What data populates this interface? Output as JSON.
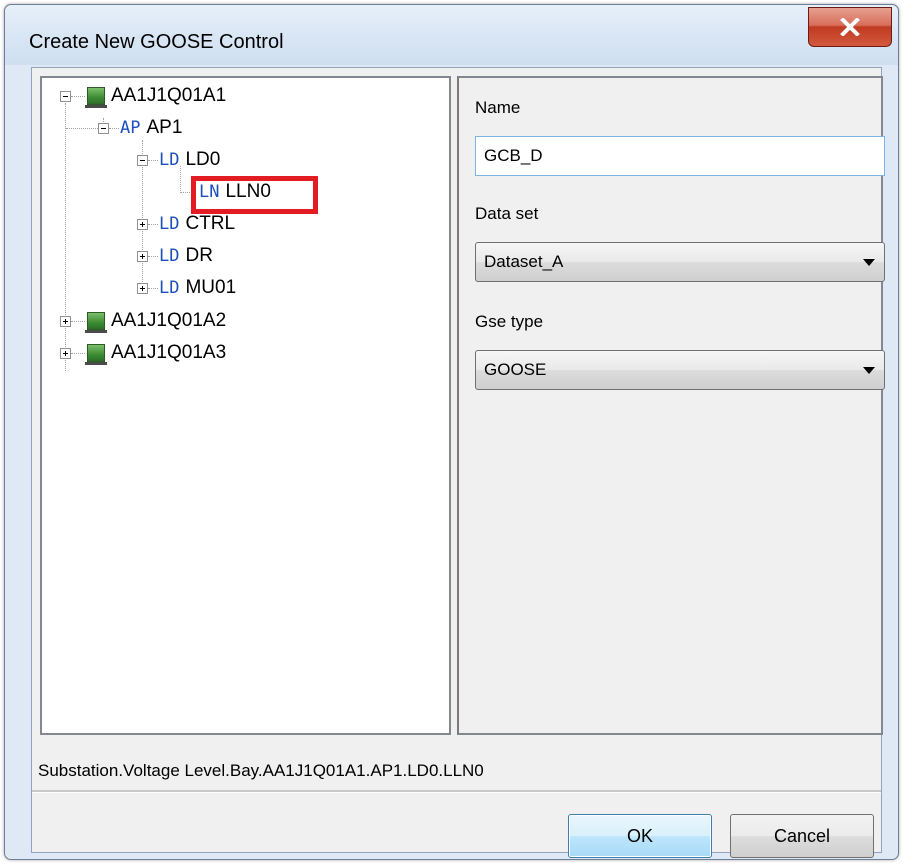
{
  "window": {
    "title": "Create New GOOSE Control",
    "close_label": "X"
  },
  "tree": {
    "nodes": [
      {
        "id": "ied1",
        "label": "AA1J1Q01A1",
        "kind": "",
        "icon": "ied-icon",
        "expanded": true
      },
      {
        "id": "ap1",
        "label": "AP1",
        "kind": "AP",
        "icon": "",
        "expanded": true
      },
      {
        "id": "ld0",
        "label": "LD0",
        "kind": "LD",
        "icon": "",
        "expanded": true
      },
      {
        "id": "lln0",
        "label": "LLN0",
        "kind": "LN",
        "icon": "",
        "selected": true
      },
      {
        "id": "ctrl",
        "label": "CTRL",
        "kind": "LD",
        "icon": "",
        "expanded": false
      },
      {
        "id": "dr",
        "label": "DR",
        "kind": "LD",
        "icon": "",
        "expanded": false
      },
      {
        "id": "mu01",
        "label": "MU01",
        "kind": "LD",
        "icon": "",
        "expanded": false
      },
      {
        "id": "ied2",
        "label": "AA1J1Q01A2",
        "kind": "",
        "icon": "ied-icon",
        "expanded": false
      },
      {
        "id": "ied3",
        "label": "AA1J1Q01A3",
        "kind": "",
        "icon": "ied-icon",
        "expanded": false
      }
    ]
  },
  "form": {
    "name_label": "Name",
    "name_value": "GCB_D",
    "dataset_label": "Data set",
    "dataset_value": "Dataset_A",
    "gsetype_label": "Gse type",
    "gsetype_value": "GOOSE"
  },
  "status": {
    "path": "Substation.Voltage Level.Bay.AA1J1Q01A1.AP1.LD0.LLN0"
  },
  "buttons": {
    "ok": "OK",
    "cancel": "Cancel"
  },
  "colors": {
    "highlight": "#e31b23",
    "node_kind": "#1f4fbf",
    "ied_icon": "#3c8c34"
  }
}
